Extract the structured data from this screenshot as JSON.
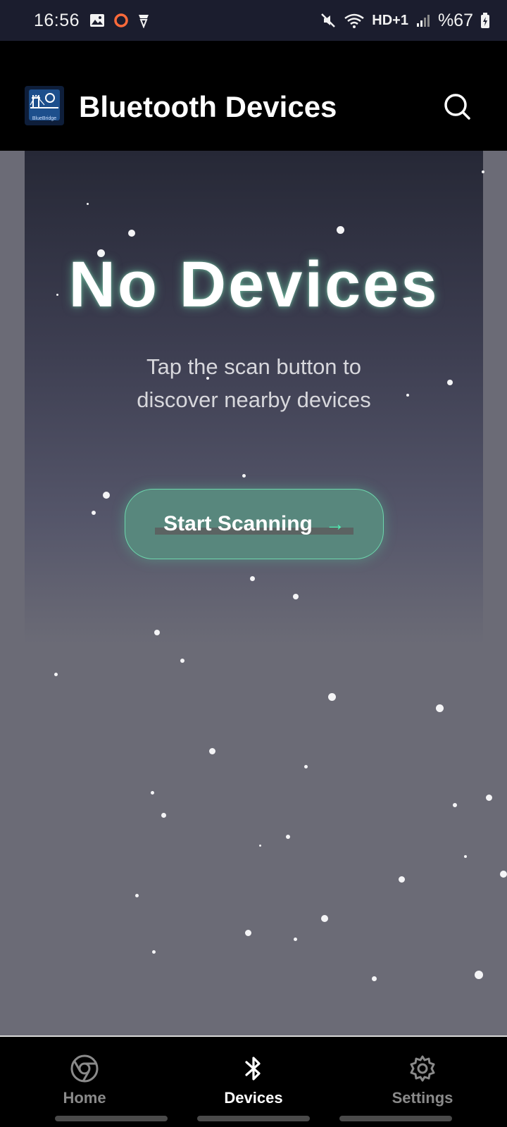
{
  "status_bar": {
    "time": "16:56",
    "battery": "%67",
    "network": "HD+1",
    "icons": [
      "gallery-icon",
      "record-icon",
      "vpn-icon",
      "mute-icon",
      "wifi-icon",
      "signal-icon",
      "battery-charging-icon"
    ]
  },
  "app_bar": {
    "logo_text": "BlueBridge",
    "title": "Bluetooth Devices",
    "search_icon": "search-icon"
  },
  "empty_state": {
    "headline": "No Devices",
    "message_line1": "Tap the scan button to",
    "message_line2": "discover nearby devices",
    "scan_button_label": "Start Scanning",
    "scan_button_arrow": "→"
  },
  "bottom_nav": {
    "items": [
      {
        "label": "Home",
        "icon": "chrome-icon",
        "active": false
      },
      {
        "label": "Devices",
        "icon": "bluetooth-icon",
        "active": true
      },
      {
        "label": "Settings",
        "icon": "gear-icon",
        "active": false
      }
    ]
  },
  "colors": {
    "status_bar": "#1b1d2e",
    "app_bar": "#000000",
    "background": "#6b6b76",
    "accent_green": "#4ff0b4",
    "button_fill": "#58877d"
  }
}
